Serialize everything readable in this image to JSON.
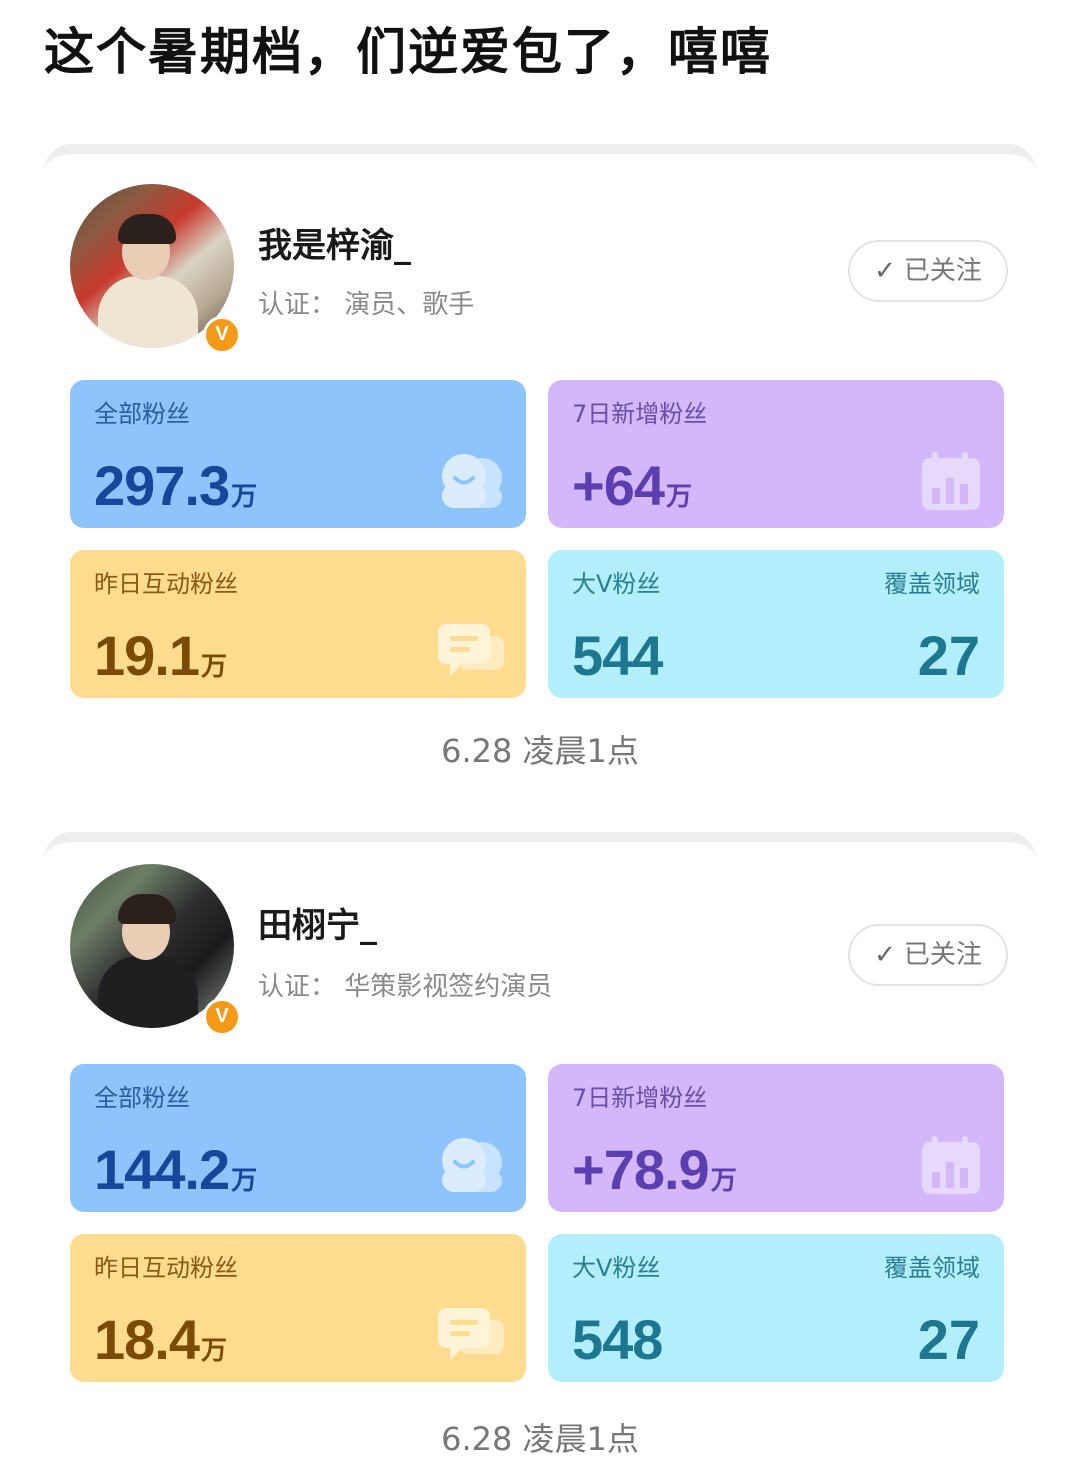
{
  "headline": "这个暑期档，们逆爱包了，嘻嘻",
  "profiles": [
    {
      "name": "我是梓渝_",
      "certification": "认证：  演员、歌手",
      "follow_label": "已关注",
      "verified_badge": "V",
      "stats": {
        "total_fans": {
          "label": "全部粉丝",
          "value": "297.3",
          "unit": "万"
        },
        "new_fans_7d": {
          "label": "7日新增粉丝",
          "value": "+64",
          "unit": "万"
        },
        "interactive_fans_yesterday": {
          "label": "昨日互动粉丝",
          "value": "19.1",
          "unit": "万"
        },
        "bigv_fans": {
          "label": "大V粉丝",
          "value": "544"
        },
        "coverage_fields": {
          "label": "覆盖领域",
          "value": "27"
        }
      },
      "timestamp": "6.28 凌晨1点"
    },
    {
      "name": "田栩宁_",
      "certification": "认证：  华策影视签约演员",
      "follow_label": "已关注",
      "verified_badge": "V",
      "stats": {
        "total_fans": {
          "label": "全部粉丝",
          "value": "144.2",
          "unit": "万"
        },
        "new_fans_7d": {
          "label": "7日新增粉丝",
          "value": "+78.9",
          "unit": "万"
        },
        "interactive_fans_yesterday": {
          "label": "昨日互动粉丝",
          "value": "18.4",
          "unit": "万"
        },
        "bigv_fans": {
          "label": "大V粉丝",
          "value": "548"
        },
        "coverage_fields": {
          "label": "覆盖领域",
          "value": "27"
        }
      },
      "timestamp": "6.28 凌晨1点"
    }
  ],
  "colors": {
    "total_fans_bg": "#8cc4fb",
    "new_fans_bg": "#d4b7fb",
    "interactive_bg": "#fddb8f",
    "bigv_bg": "#b3eefc",
    "verified_badge": "#f59a16"
  },
  "icons": {
    "total_fans": "fans-group-icon",
    "new_fans_7d": "calendar-chart-icon",
    "interactive_fans_yesterday": "chat-bubble-icon",
    "follow": "check-icon"
  }
}
